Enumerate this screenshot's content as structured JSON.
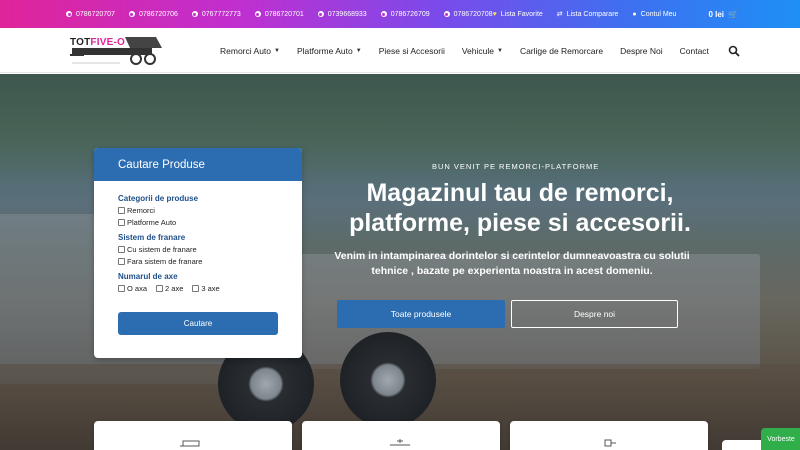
{
  "topbar": {
    "phones": [
      "0786720707",
      "0786720706",
      "0767772773",
      "0786720701",
      "0739668933",
      "0786726709",
      "0786720708"
    ],
    "links": [
      {
        "label": "Lista Favorite",
        "icon": "heart-icon"
      },
      {
        "label": "Lista Comparare",
        "icon": "compare-icon"
      },
      {
        "label": "Contul Meu",
        "icon": "user-icon"
      }
    ],
    "cart_total": "0 lei",
    "colors": {
      "gradient_start": "#e0249a",
      "gradient_end": "#1e90f5"
    }
  },
  "header": {
    "logo_text_a": "TOT",
    "logo_text_b": "FIVE-O",
    "nav": [
      {
        "label": "Remorci Auto",
        "dropdown": true
      },
      {
        "label": "Platforme Auto",
        "dropdown": true
      },
      {
        "label": "Piese si Accesorii",
        "dropdown": false
      },
      {
        "label": "Vehicule",
        "dropdown": true
      },
      {
        "label": "Carlige de Remorcare",
        "dropdown": false
      },
      {
        "label": "Despre Noi",
        "dropdown": false
      },
      {
        "label": "Contact",
        "dropdown": false
      }
    ]
  },
  "search_card": {
    "title": "Cautare Produse",
    "groups": [
      {
        "title": "Categorii de produse",
        "options": [
          "Remorci",
          "Platforme Auto"
        ]
      },
      {
        "title": "Sistem de franare",
        "options": [
          "Cu sistem de franare",
          "Fara sistem de franare"
        ]
      },
      {
        "title": "Numarul de axe",
        "options": [
          "O axa",
          "2 axe",
          "3 axe"
        ]
      }
    ],
    "submit_label": "Cautare",
    "accent": "#2c6db1"
  },
  "hero": {
    "kicker": "BUN VENIT PE REMORCI-PLATFORME",
    "title": "Magazinul tau de remorci, platforme, piese si accesorii.",
    "subtitle": "Venim in intampinarea dorintelor si cerintelor dumneavoastra cu solutii tehnice , bazate pe experienta noastra in acest domeniu.",
    "primary_button": "Toate produsele",
    "secondary_button": "Despre noi"
  },
  "chat": {
    "label": "Vorbeste"
  }
}
